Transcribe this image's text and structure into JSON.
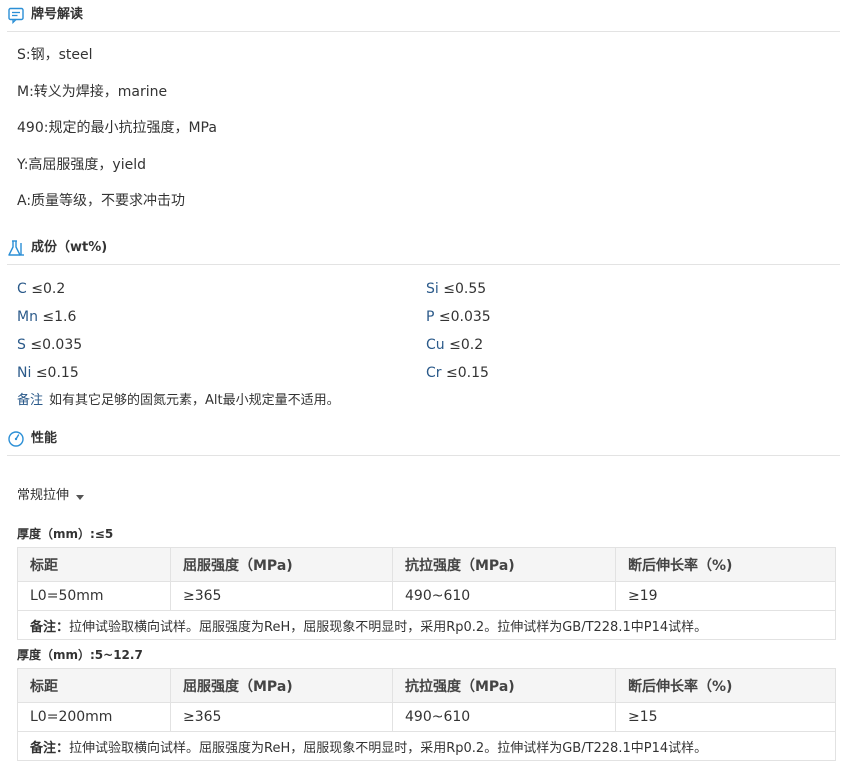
{
  "sections": {
    "designation": {
      "title": "牌号解读"
    },
    "composition": {
      "title": "成份（wt%)"
    },
    "properties": {
      "title": "性能"
    }
  },
  "designation_lines": [
    "S:钢，steel",
    "M:转义为焊接，marine",
    "490:规定的最小抗拉强度，MPa",
    "Y:高屈服强度，yield",
    "A:质量等级，不要求冲击功"
  ],
  "composition": {
    "rows": [
      [
        {
          "el": "C",
          "val": " ≤0.2"
        },
        {
          "el": "Si",
          "val": " ≤0.55"
        }
      ],
      [
        {
          "el": "Mn",
          "val": " ≤1.6"
        },
        {
          "el": "P",
          "val": " ≤0.035"
        }
      ],
      [
        {
          "el": "S",
          "val": " ≤0.035"
        },
        {
          "el": "Cu",
          "val": " ≤0.2"
        }
      ],
      [
        {
          "el": "Ni",
          "val": " ≤0.15"
        },
        {
          "el": "Cr",
          "val": " ≤0.15"
        }
      ]
    ],
    "note_label": "备注",
    "note_text": "如有其它足够的固氮元素，Alt最小规定量不适用。"
  },
  "properties": {
    "dropdown_label": "常规拉伸",
    "tables": [
      {
        "thickness": "厚度（mm）:≤5",
        "headers": [
          "标距",
          "屈服强度（MPa)",
          "抗拉强度（MPa)",
          "断后伸长率（%)"
        ],
        "row": [
          "L0=50mm",
          "≥365",
          "490~610",
          "≥19"
        ],
        "note_label": "备注：",
        "note_text": "拉伸试验取横向试样。屈服强度为ReH，屈服现象不明显时，采用Rp0.2。拉伸试样为GB/T228.1中P14试样。"
      },
      {
        "thickness": "厚度（mm）:5~12.7",
        "headers": [
          "标距",
          "屈服强度（MPa)",
          "抗拉强度（MPa)",
          "断后伸长率（%)"
        ],
        "row": [
          "L0=200mm",
          "≥365",
          "490~610",
          "≥15"
        ],
        "note_label": "备注：",
        "note_text": "拉伸试验取横向试样。屈服强度为ReH，屈服现象不明显时，采用Rp0.2。拉伸试样为GB/T228.1中P14试样。"
      }
    ]
  },
  "colors": {
    "accent": "#2b8fd6",
    "element_label": "#2b5a8a",
    "border": "#e3e3e3",
    "header_bg": "#f5f5f5"
  },
  "icons": {
    "designation": "message-icon",
    "composition": "flask-icon",
    "properties": "gauge-icon"
  }
}
